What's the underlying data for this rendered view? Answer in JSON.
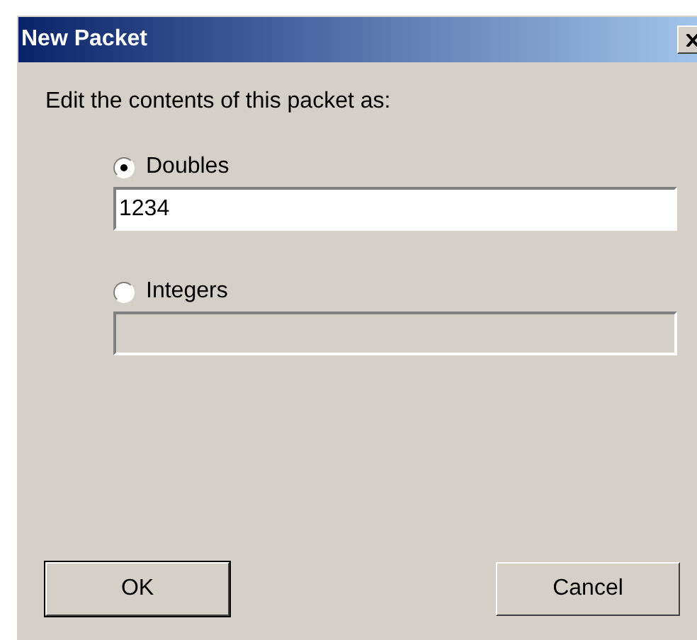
{
  "window": {
    "title": "New Packet"
  },
  "prompt": "Edit the contents of this packet as:",
  "options": [
    {
      "label": "Doubles",
      "selected": true,
      "field": {
        "value": "1234",
        "disabled": false
      }
    },
    {
      "label": "Integers",
      "selected": false,
      "field": {
        "disabled": true
      }
    }
  ],
  "buttons": [
    {
      "label": "OK",
      "default": true
    },
    {
      "label": "Cancel",
      "default": false
    }
  ]
}
